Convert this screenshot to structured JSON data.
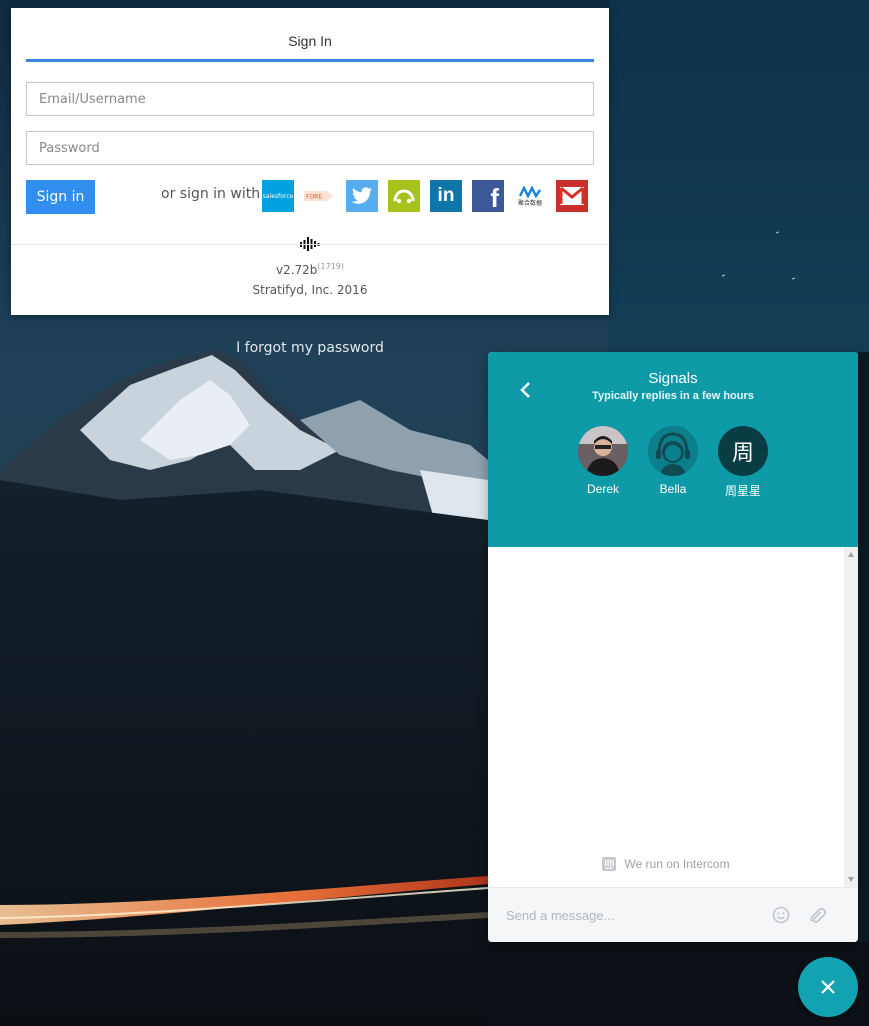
{
  "signin": {
    "tab_label": "Sign In",
    "email_placeholder": "Email/Username",
    "password_placeholder": "Password",
    "button_label": "Sign in",
    "or_text": "or sign in with",
    "social_providers": [
      {
        "name": "salesforce",
        "label": "salesforce",
        "color": "#00a1e0"
      },
      {
        "name": "forcegrid",
        "label": "FORE",
        "color": "#e85b2a"
      },
      {
        "name": "twitter",
        "color": "#55acee"
      },
      {
        "name": "cloud",
        "color": "#a6c21d"
      },
      {
        "name": "linkedin",
        "label": "in",
        "color": "#0e76a8"
      },
      {
        "name": "facebook",
        "label": "f",
        "color": "#3b5998"
      },
      {
        "name": "juhe",
        "label": "聚合数据",
        "color": "#1b84d8"
      },
      {
        "name": "gmail",
        "label": "M",
        "color": "#d93025"
      }
    ],
    "version": "v2.72b",
    "build": "(1719)",
    "company": "Stratifyd, Inc. 2016"
  },
  "forgot_link": "I forgot my password",
  "chat": {
    "title": "Signals",
    "subtitle": "Typically replies in a few hours",
    "agents": [
      {
        "name": "Derek"
      },
      {
        "name": "Bella"
      },
      {
        "name": "周星星",
        "initial": "周"
      }
    ],
    "powered_by": "We run on Intercom",
    "message_placeholder": "Send a message...",
    "accent_color": "#0f9aa8"
  }
}
